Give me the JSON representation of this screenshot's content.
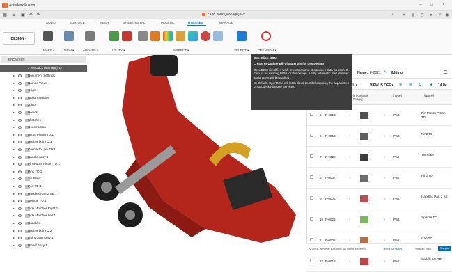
{
  "app": {
    "title": "Autodesk Fusion"
  },
  "document": {
    "tab_title": "2 Ton Jack (Manage) v2*"
  },
  "ribbon": {
    "tabs": [
      "SOLID",
      "SURFACE",
      "MESH",
      "SHEET METAL",
      "PLASTIC",
      "UTILITIES",
      "MANAGE"
    ],
    "active_tab": "UTILITIES",
    "workspace": "DESIGN ▾",
    "groups": [
      "MAKE ▾",
      "NEW ▾",
      "ADD-INS ▾",
      "UTILITY ▾",
      "INSPECT ▾",
      "SELECT ▾",
      "OPENBOM ▾"
    ]
  },
  "browser": {
    "title": "BROWSER",
    "root": "2 Ton Jack (Manage) v2",
    "items": [
      "Document Settings",
      "Named Views",
      "Origin",
      "Motion Studies",
      "Joints",
      "Bodies",
      "Sketches",
      "Construction",
      "Acme Piston TD:1",
      "Anchor bolt TD:1",
      "Connector pin TD:1",
      "Handle Assy:1",
      "Pin Mount Piston TD:1",
      "Pin1 TD:1",
      "Tin Plate:1",
      "Port TD:1",
      "Handles Part 2 SE:1",
      "Spindle TD:1",
      "Side Member Right:1",
      "Side Member Left:1",
      "Handle:1",
      "Anchor bolt TD:2",
      "Lifting Arm Assy:1",
      "Wheel Assy:1"
    ]
  },
  "tooltip": {
    "title": "One-Click-BOM",
    "subtitle": "Create or Update Bill of Materials for this Design",
    "body1": "OpenBOM simplifies work processes and streamlines data creation. If there is no existing BOM for this design, a fully automatic Part Number assignment will be applied.",
    "body2": "By default, OpenBOM will fetch cloud thumbnails using the capabilities of Autodesk Platform Services."
  },
  "bom": {
    "name_label": "Name:",
    "name_value": "F-0021",
    "editing": "Editing",
    "view_is_off": "VIEW IS OFF ▾",
    "level_label": "EL ▾",
    "count_label": "14 Ite",
    "columns": [
      "[Thumbnail Image]",
      "[Type]",
      "[Name]"
    ],
    "rows": [
      {
        "num": "5",
        "pn": "F-0013",
        "type": "Part",
        "name": "Pin Mount Piston TD"
      },
      {
        "num": "6",
        "pn": "F-0012",
        "type": "Part",
        "name": "Pin2 TD"
      },
      {
        "num": "7",
        "pn": "F-0029",
        "type": "Part",
        "name": "Tin Plate"
      },
      {
        "num": "8",
        "pn": "F-0007",
        "type": "Part",
        "name": "Pin1 TD"
      },
      {
        "num": "9",
        "pn": "F-0006",
        "type": "Part",
        "name": "Handles Part 2 SE"
      },
      {
        "num": "10",
        "pn": "F-0025",
        "type": "Part",
        "name": "Spindle TD"
      },
      {
        "num": "11",
        "pn": "F-0005",
        "type": "Part",
        "name": "Cap TD"
      },
      {
        "num": "12",
        "pn": "F-0019",
        "type": "Part",
        "name": "Saddle Up TD"
      }
    ],
    "footer_copyright": "© 2024 - Newmar Cloud Inc. All Rights Reserved.",
    "footer_terms": "Terms & Privacy",
    "footer_version": "Version: main",
    "footer_support": "Support"
  },
  "colors": {
    "accent": "#0a6ebd",
    "jack_red": "#b4261c",
    "tooltip_bg": "#3c3c3c"
  }
}
